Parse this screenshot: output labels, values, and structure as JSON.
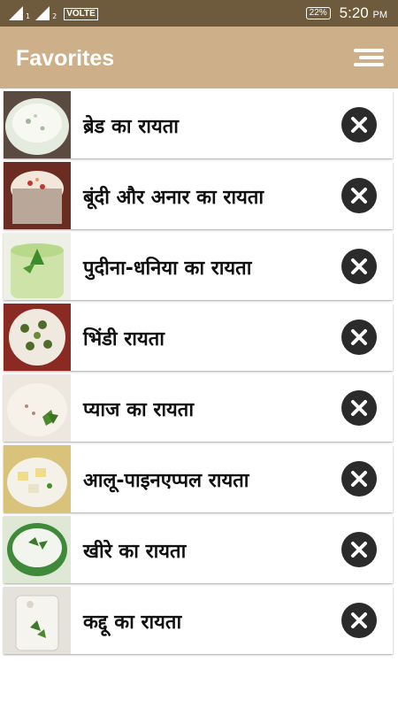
{
  "status_bar": {
    "sim1": "1",
    "sim2": "2",
    "network": "VOLTE",
    "battery": "22%",
    "time": "5:20",
    "ampm": "PM"
  },
  "app_bar": {
    "title": "Favorites",
    "menu_icon": "sort-menu-icon"
  },
  "favorites": [
    {
      "title": "ब्रेड का रायता",
      "icon": "close-icon"
    },
    {
      "title": "बूंदी और अनार का रायता",
      "icon": "close-icon"
    },
    {
      "title": "पुदीना-धनिया का रायता",
      "icon": "close-icon"
    },
    {
      "title": "भिंडी रायता",
      "icon": "close-icon"
    },
    {
      "title": "प्याज का रायता",
      "icon": "close-icon"
    },
    {
      "title": "आलू-पाइनएप्पल रायता",
      "icon": "close-icon"
    },
    {
      "title": "खीरे का रायता",
      "icon": "close-icon"
    },
    {
      "title": "कद्दू का रायता",
      "icon": "close-icon"
    }
  ],
  "colors": {
    "status_bar": "#6e5a3c",
    "app_bar": "#cdb08a",
    "remove_button": "#2b2b2b"
  }
}
